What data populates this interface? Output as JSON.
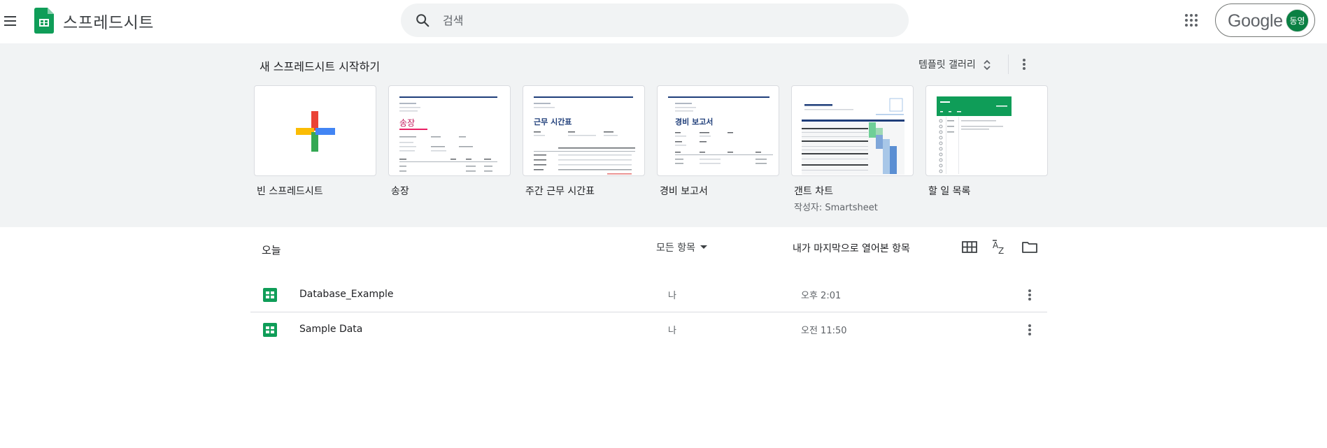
{
  "header": {
    "app_title": "스프레드시트",
    "search_placeholder": "검색",
    "account_brand": "Google",
    "avatar_initials": "동영"
  },
  "templates": {
    "section_title": "새 스프레드시트 시작하기",
    "gallery_label": "템플릿 갤러리",
    "items": [
      {
        "label": "빈 스프레드시트"
      },
      {
        "label": "송장"
      },
      {
        "label": "주간 근무 시간표"
      },
      {
        "label": "경비 보고서"
      },
      {
        "label": "갠트 차트",
        "sublabel": "작성자: Smartsheet"
      },
      {
        "label": "할 일 목록"
      }
    ]
  },
  "thumbnails": {
    "invoice_title": "송장",
    "timesheet_title": "근무 시간표",
    "expense_title": "경비 보고서"
  },
  "list": {
    "section_label": "오늘",
    "owner_filter": "모든 항목",
    "sort_label": "내가 마지막으로 열어본 항목",
    "rows": [
      {
        "name": "Database_Example",
        "owner": "나",
        "date": "오후 2:01"
      },
      {
        "name": "Sample Data",
        "owner": "나",
        "date": "오전 11:50"
      }
    ]
  },
  "colors": {
    "sheets_green": "#0f9d58",
    "header_bg": "#f1f3f4",
    "avatar_bg": "#0b8043",
    "navy_accent": "#1f3e7a"
  }
}
